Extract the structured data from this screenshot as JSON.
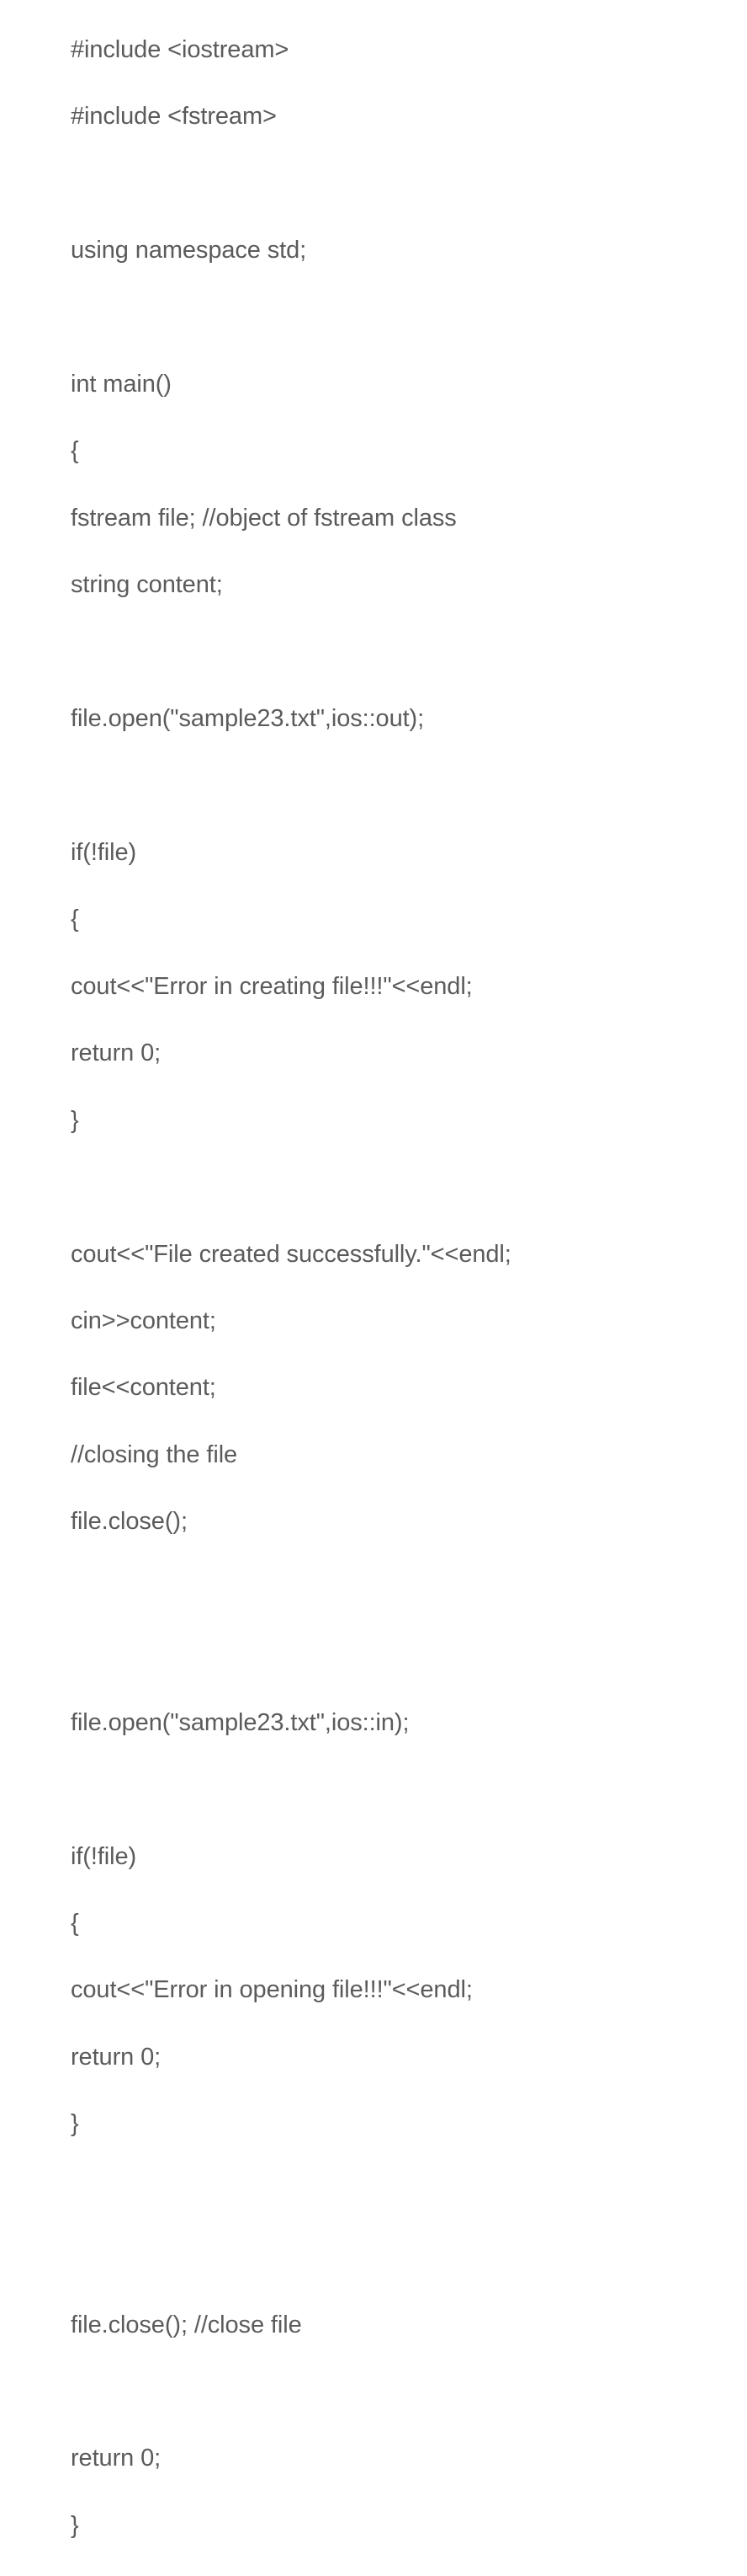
{
  "code": {
    "lines": [
      "#include <iostream>",
      "#include <fstream>",
      "",
      "using namespace std;",
      "",
      "int main()",
      "{",
      "fstream file; //object of fstream class",
      "string content;",
      "",
      "file.open(\"sample23.txt\",ios::out);",
      "",
      "if(!file)",
      "{",
      "cout<<\"Error in creating file!!!\"<<endl;",
      "return 0;",
      "}",
      "",
      "cout<<\"File created successfully.\"<<endl;",
      "cin>>content;",
      "file<<content;",
      "//closing the file",
      "file.close();",
      "",
      "",
      "file.open(\"sample23.txt\",ios::in);",
      "",
      "if(!file)",
      "{",
      "cout<<\"Error in opening file!!!\"<<endl;",
      "return 0;",
      "}",
      "",
      "",
      "file.close(); //close file",
      "",
      "return 0;",
      "}"
    ]
  }
}
